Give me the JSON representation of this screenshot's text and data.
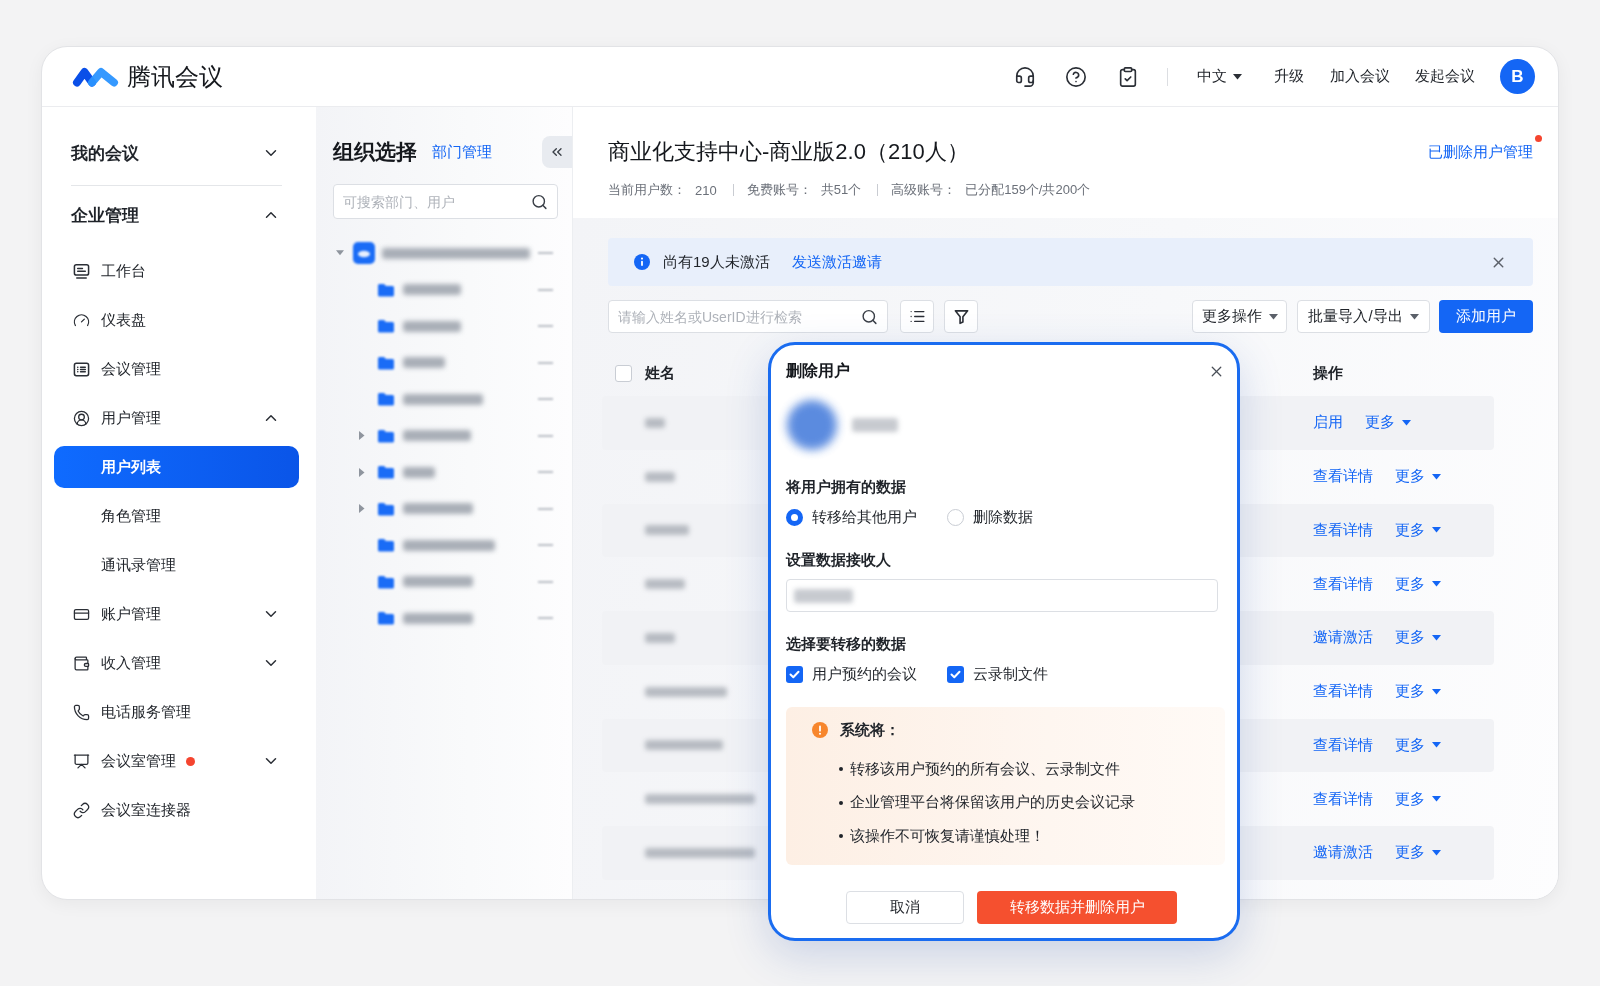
{
  "header": {
    "logo_text": "腾讯会议",
    "language": "中文",
    "links": [
      "升级",
      "加入会议",
      "发起会议"
    ],
    "avatar": "B"
  },
  "sidebar": {
    "sections": [
      {
        "label": "我的会议",
        "expanded": false
      },
      {
        "label": "企业管理",
        "expanded": true,
        "children": [
          {
            "label": "工作台",
            "selected": false
          },
          {
            "label": "仪表盘",
            "selected": false
          },
          {
            "label": "会议管理",
            "selected": false
          },
          {
            "label": "用户管理",
            "selected": false,
            "expanded": true,
            "children": [
              {
                "label": "用户列表",
                "selected": true
              },
              {
                "label": "角色管理",
                "selected": false
              },
              {
                "label": "通讯录管理",
                "selected": false
              }
            ]
          },
          {
            "label": "账户管理",
            "selected": false,
            "expanded": false
          },
          {
            "label": "收入管理",
            "selected": false,
            "expanded": false
          },
          {
            "label": "电话服务管理",
            "selected": false
          },
          {
            "label": "会议室管理",
            "selected": false,
            "expanded": false,
            "notification_dot": true
          },
          {
            "label": "会议室连接器",
            "selected": false
          }
        ]
      }
    ]
  },
  "org_panel": {
    "title": "组织选择",
    "link": "部门管理",
    "search": {
      "placeholder": "可搜索部门、用户"
    },
    "tree": {
      "kind": "org",
      "expanded": true,
      "children": [
        {
          "kind": "folder"
        },
        {
          "kind": "folder"
        },
        {
          "kind": "folder"
        },
        {
          "kind": "folder"
        },
        {
          "kind": "folder",
          "expanded": false
        },
        {
          "kind": "folder",
          "expanded": false
        },
        {
          "kind": "folder",
          "expanded": false
        },
        {
          "kind": "folder"
        },
        {
          "kind": "folder"
        },
        {
          "kind": "folder"
        }
      ]
    }
  },
  "main": {
    "title": "商业化支持中心-商业版2.0（210人）",
    "deleted_users_link": {
      "label": "已删除用户管理",
      "notification_dot": true
    },
    "stats": [
      {
        "label": "当前用户数：",
        "value": "210"
      },
      {
        "label": "免费账号：",
        "value": "共51个"
      },
      {
        "label": "高级账号：",
        "value": "已分配159个/共200个"
      }
    ],
    "banner": {
      "text": "尚有19人未激活",
      "link": "发送激活邀请"
    },
    "search": {
      "placeholder": "请输入姓名或UserID进行检索"
    },
    "menus": [
      "更多操作",
      "批量导入/导出"
    ],
    "add_button": "添加用户",
    "table": {
      "select_all": {
        "checked": false
      },
      "columns": [
        "姓名",
        "操作"
      ],
      "rows": [
        {
          "actions": [
            {
              "kind": "link",
              "label": "启用"
            },
            {
              "kind": "menu",
              "label": "更多"
            }
          ]
        },
        {
          "actions": [
            {
              "kind": "link",
              "label": "查看详情"
            },
            {
              "kind": "menu",
              "label": "更多"
            }
          ]
        },
        {
          "actions": [
            {
              "kind": "link",
              "label": "查看详情"
            },
            {
              "kind": "menu",
              "label": "更多"
            }
          ]
        },
        {
          "actions": [
            {
              "kind": "link",
              "label": "查看详情"
            },
            {
              "kind": "menu",
              "label": "更多"
            }
          ]
        },
        {
          "actions": [
            {
              "kind": "link",
              "label": "邀请激活"
            },
            {
              "kind": "menu",
              "label": "更多"
            }
          ]
        },
        {
          "actions": [
            {
              "kind": "link",
              "label": "查看详情"
            },
            {
              "kind": "menu",
              "label": "更多"
            }
          ]
        },
        {
          "actions": [
            {
              "kind": "link",
              "label": "查看详情"
            },
            {
              "kind": "menu",
              "label": "更多"
            }
          ]
        },
        {
          "actions": [
            {
              "kind": "link",
              "label": "查看详情"
            },
            {
              "kind": "menu",
              "label": "更多"
            }
          ]
        },
        {
          "actions": [
            {
              "kind": "link",
              "label": "邀请激活"
            },
            {
              "kind": "menu",
              "label": "更多"
            }
          ]
        }
      ]
    }
  },
  "modal": {
    "title": "删除用户",
    "data_label": "将用户拥有的数据",
    "data_options": [
      {
        "label": "转移给其他用户",
        "selected": true
      },
      {
        "label": "删除数据",
        "selected": false
      }
    ],
    "recipient_label": "设置数据接收人",
    "transfer_label": "选择要转移的数据",
    "transfer_items": [
      {
        "label": "用户预约的会议",
        "checked": true
      },
      {
        "label": "云录制文件",
        "checked": true
      }
    ],
    "notice": {
      "title": "系统将：",
      "items": [
        "转移该用户预约的所有会议、云录制文件",
        "企业管理平台将保留该用户的历史会议记录",
        "该操作不可恢复请谨慎处理！"
      ]
    },
    "buttons": {
      "cancel": "取消",
      "confirm": "转移数据并删除用户"
    }
  }
}
